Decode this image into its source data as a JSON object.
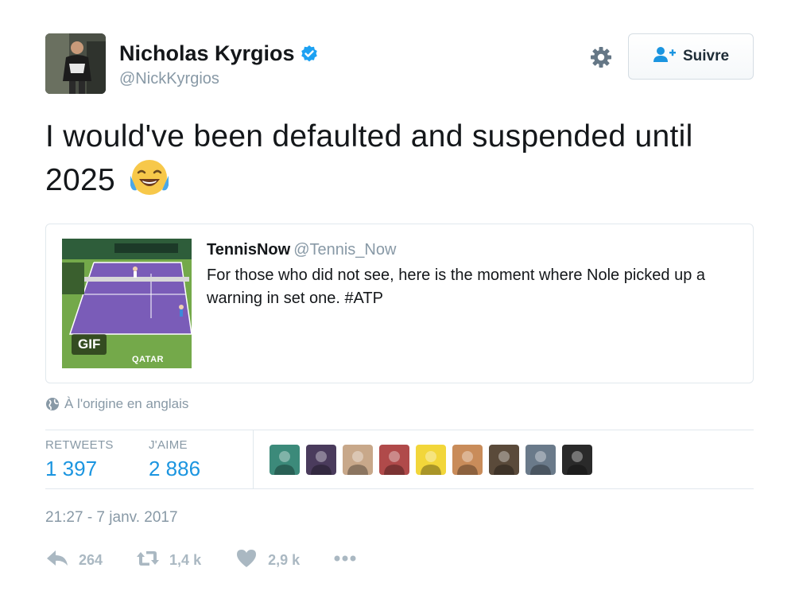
{
  "author": {
    "name": "Nicholas Kyrgios",
    "handle": "@NickKyrgios"
  },
  "follow_button": {
    "label": "Suivre"
  },
  "tweet": {
    "text": "I would've been defaulted and suspended until 2025",
    "emoji": "face-with-tears-of-joy"
  },
  "quoted_tweet": {
    "name": "TennisNow",
    "handle": "@Tennis_Now",
    "text": "For those who did not see, here is the moment where Nole picked up a warning in set one. #ATP",
    "media_badge": "GIF",
    "media_caption": "QATAR"
  },
  "translate": {
    "label": "À l'origine en anglais"
  },
  "stats": {
    "retweets_label": "RETWEETS",
    "retweets_value": "1 397",
    "likes_label": "J'AIME",
    "likes_value": "2 886"
  },
  "liker_avatars": [
    "#3c8a7a",
    "#4a3b5c",
    "#c8a88a",
    "#b04a4a",
    "#f2d63a",
    "#c98c5a",
    "#5a4a3a",
    "#6a7a8a",
    "#2a2a2a"
  ],
  "timestamp": "21:27 - 7 janv. 2017",
  "actions": {
    "reply_count": "264",
    "retweet_count": "1,4 k",
    "like_count": "2,9 k"
  },
  "colors": {
    "accent": "#1b95e0",
    "muted": "#8899a6",
    "icon": "#aab8c2",
    "verified": "#1da1f2"
  }
}
